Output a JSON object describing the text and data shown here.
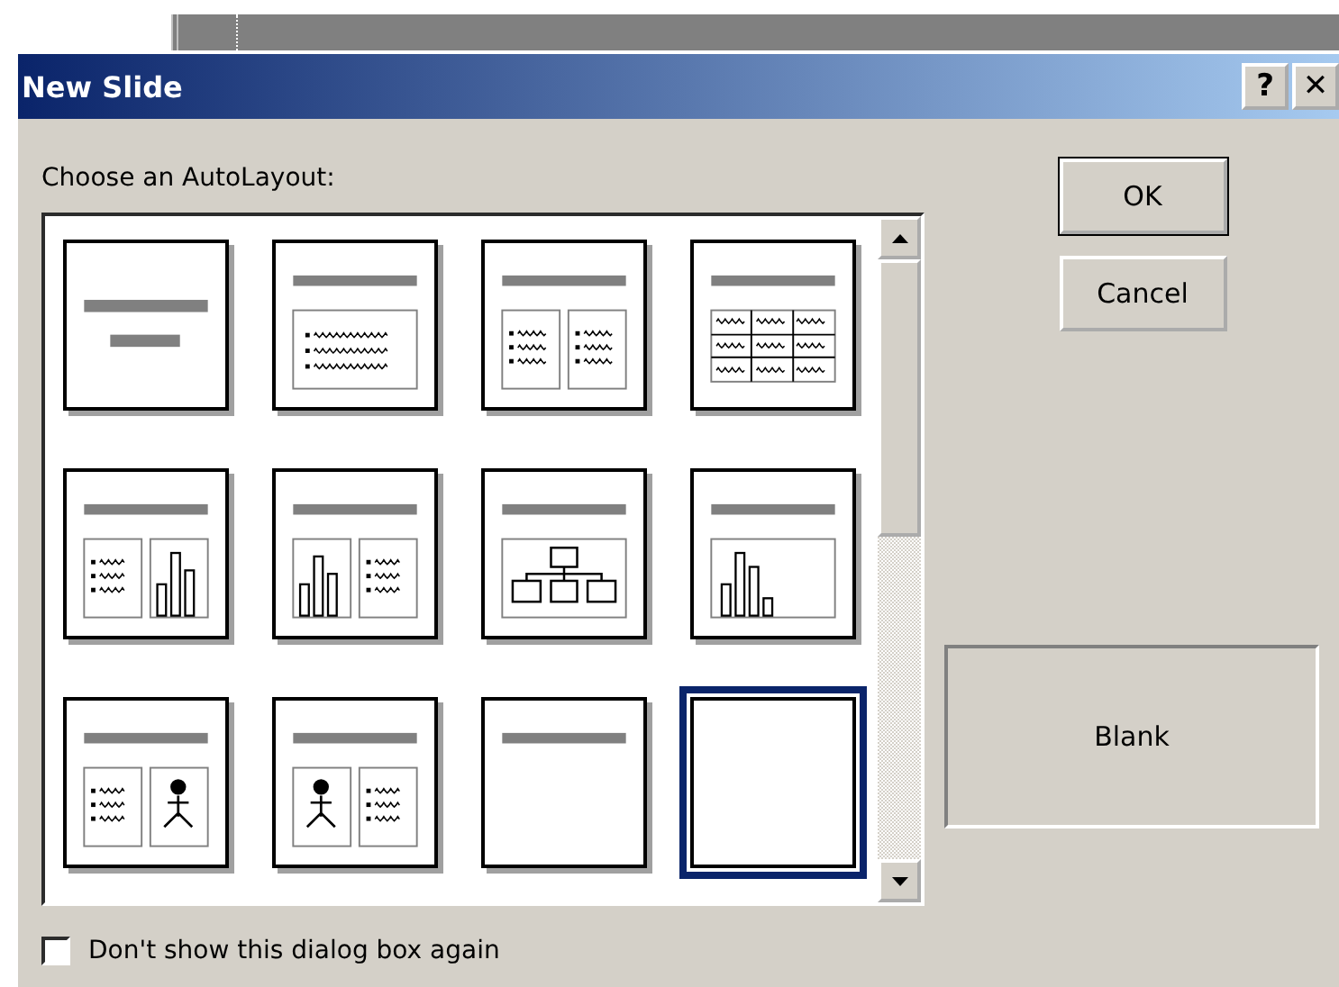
{
  "window": {
    "title": "New Slide",
    "title_buttons": [
      "?",
      "✕"
    ]
  },
  "prompt": "Choose an AutoLayout:",
  "layouts": [
    {
      "kind": "title",
      "selected": false
    },
    {
      "kind": "bulleted-list",
      "selected": false
    },
    {
      "kind": "two-column",
      "selected": false
    },
    {
      "kind": "table",
      "selected": false
    },
    {
      "kind": "text-chart",
      "selected": false
    },
    {
      "kind": "chart-text",
      "selected": false
    },
    {
      "kind": "org-chart",
      "selected": false
    },
    {
      "kind": "chart",
      "selected": false
    },
    {
      "kind": "text-clipart",
      "selected": false
    },
    {
      "kind": "clipart-text",
      "selected": false
    },
    {
      "kind": "title-only",
      "selected": false
    },
    {
      "kind": "blank",
      "selected": true
    }
  ],
  "buttons": [
    "OK",
    "Cancel"
  ],
  "preview": {
    "name": "Blank"
  },
  "dont_show_again": {
    "label": "Don't show this dialog box again",
    "checked": false
  }
}
